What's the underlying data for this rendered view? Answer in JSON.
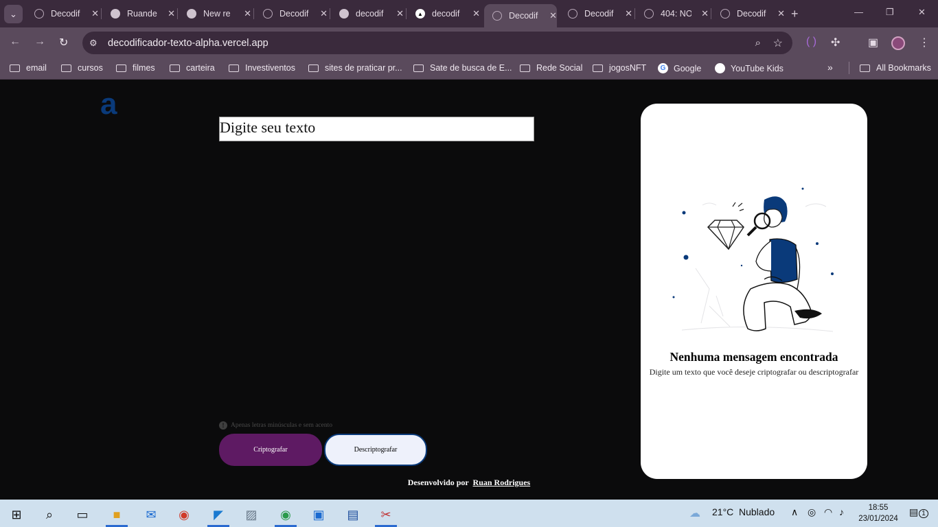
{
  "browser": {
    "tabs": [
      {
        "label": "Decodif",
        "icon": "globe-icon"
      },
      {
        "label": "Ruande",
        "icon": "github-icon"
      },
      {
        "label": "New re",
        "icon": "github-icon"
      },
      {
        "label": "Decodif",
        "icon": "globe-icon"
      },
      {
        "label": "decodif",
        "icon": "github-icon"
      },
      {
        "label": "decodif",
        "icon": "vercel-icon"
      },
      {
        "label": "Decodif",
        "icon": "globe-icon",
        "active": true
      },
      {
        "label": "Decodif",
        "icon": "globe-icon"
      },
      {
        "label": "404: NO",
        "icon": "globe-icon"
      },
      {
        "label": "Decodif",
        "icon": "globe-icon"
      }
    ],
    "url": "decodificador-texto-alpha.vercel.app",
    "bookmarks": [
      {
        "label": "email",
        "type": "folder"
      },
      {
        "label": "cursos",
        "type": "folder"
      },
      {
        "label": "filmes",
        "type": "folder"
      },
      {
        "label": "carteira",
        "type": "folder"
      },
      {
        "label": "Investiventos",
        "type": "folder"
      },
      {
        "label": "sites de praticar pr...",
        "type": "folder"
      },
      {
        "label": "Sate de busca de E...",
        "type": "folder"
      },
      {
        "label": "Rede Social",
        "type": "folder"
      },
      {
        "label": "jogosNFT",
        "type": "folder"
      },
      {
        "label": "Google",
        "type": "google"
      },
      {
        "label": "YouTube Kids",
        "type": "youtube"
      }
    ],
    "all_bookmarks": "All Bookmarks"
  },
  "app": {
    "logo": "a",
    "input_placeholder": "Digite seu texto",
    "hint": "Apenas letras minúsculas e sem acento",
    "encrypt_label": "Criptografar",
    "decrypt_label": "Descriptografar",
    "footer_prefix": "Desenvolvido por",
    "footer_author": "Ruan Rodrigues",
    "result_title": "Nenhuma mensagem encontrada",
    "result_subtitle": "Digite um texto que você deseje criptografar ou descriptografar",
    "colors": {
      "primary": "#0a3a7a",
      "encrypt_bg": "#5e1a63",
      "decrypt_bg": "#eef1fb",
      "page_bg": "#0b0b0c"
    }
  },
  "taskbar": {
    "weather_temp": "21°C",
    "weather_desc": "Nublado",
    "time": "18:55",
    "date": "23/01/2024",
    "notifications": "1"
  }
}
